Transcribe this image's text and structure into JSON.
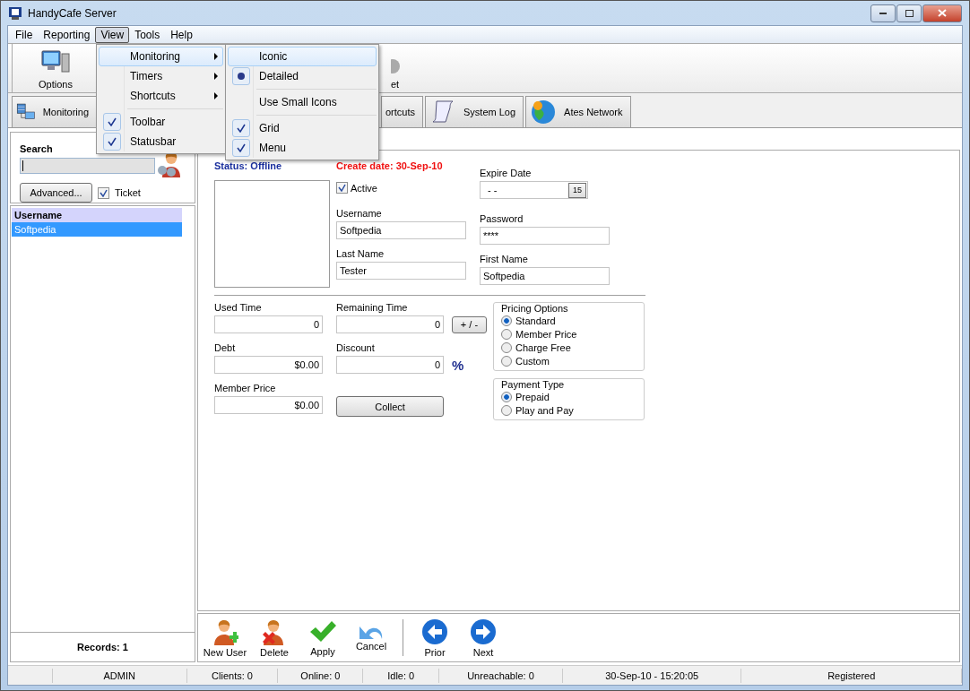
{
  "window": {
    "title": "HandyCafe Server"
  },
  "menu_bar": [
    {
      "label": "File",
      "selected": false
    },
    {
      "label": "Reporting",
      "selected": false
    },
    {
      "label": "View",
      "selected": true
    },
    {
      "label": "Tools",
      "selected": false
    },
    {
      "label": "Help",
      "selected": false
    }
  ],
  "toolbar": {
    "buttons": [
      {
        "label": "Options",
        "kind": "computer"
      },
      {
        "label": "et",
        "kind": "partial"
      }
    ]
  },
  "tabs": [
    {
      "label": "Monitoring",
      "kind": "servers",
      "selected": false
    },
    {
      "label": "ortcuts",
      "kind": "plain",
      "selected": false
    },
    {
      "label": "System Log",
      "kind": "scroll",
      "selected": false
    },
    {
      "label": "Ates Network",
      "kind": "globe",
      "selected": false
    }
  ],
  "view_menu": [
    {
      "kind": "submenu",
      "label": "Monitoring",
      "selected": true
    },
    {
      "kind": "submenu",
      "label": "Timers",
      "selected": false
    },
    {
      "kind": "submenu",
      "label": "Shortcuts",
      "selected": false
    },
    {
      "kind": "separator"
    },
    {
      "kind": "check",
      "label": "Toolbar",
      "checked": true,
      "selected": false
    },
    {
      "kind": "check",
      "label": "Statusbar",
      "checked": true,
      "selected": false
    }
  ],
  "monitoring_submenu": [
    {
      "kind": "radio",
      "label": "Iconic",
      "checked": false,
      "selected": true
    },
    {
      "kind": "radio",
      "label": "Detailed",
      "checked": true,
      "selected": false
    },
    {
      "kind": "separator"
    },
    {
      "kind": "check",
      "label": "Use Small Icons",
      "checked": false,
      "selected": false
    },
    {
      "kind": "separator"
    },
    {
      "kind": "check",
      "label": "Grid",
      "checked": true,
      "selected": false
    },
    {
      "kind": "check",
      "label": "Menu",
      "checked": true,
      "selected": false
    }
  ],
  "search": {
    "label": "Search",
    "advanced_button": "Advanced...",
    "ticket": {
      "label": "Ticket",
      "checked": true
    }
  },
  "user_list": {
    "header": "Username",
    "rows": [
      {
        "label": "Softpedia",
        "selected": true
      }
    ],
    "records": "Records: 1"
  },
  "details": {
    "status": "Status: Offline",
    "create_date": "Create date: 30-Sep-10",
    "active": {
      "label": "Active",
      "checked": true
    },
    "expire_date": {
      "label": "Expire Date",
      "value": "- -",
      "calendar": "15"
    },
    "username": {
      "label": "Username",
      "value": "Softpedia"
    },
    "password": {
      "label": "Password",
      "value": "****"
    },
    "last_name": {
      "label": "Last Name",
      "value": "Tester"
    },
    "first_name": {
      "label": "First Name",
      "value": "Softpedia"
    },
    "used_time": {
      "label": "Used Time",
      "value": "0"
    },
    "remaining_time": {
      "label": "Remaining Time",
      "value": "0",
      "button": "+ / -"
    },
    "debt": {
      "label": "Debt",
      "value": "$0.00"
    },
    "discount": {
      "label": "Discount",
      "value": "0",
      "unit": "%"
    },
    "member_price": {
      "label": "Member Price",
      "value": "$0.00"
    },
    "collect_button": "Collect",
    "pricing_options": {
      "title": "Pricing Options",
      "options": [
        {
          "label": "Standard",
          "selected": true
        },
        {
          "label": "Member Price",
          "selected": false
        },
        {
          "label": "Charge Free",
          "selected": false
        },
        {
          "label": "Custom",
          "selected": false
        }
      ]
    },
    "payment_type": {
      "title": "Payment Type",
      "options": [
        {
          "label": "Prepaid",
          "selected": true
        },
        {
          "label": "Play and Pay",
          "selected": false
        }
      ]
    }
  },
  "user_toolbar": [
    {
      "label": "New User",
      "kind": "new-user"
    },
    {
      "label": "Delete",
      "kind": "delete-user"
    },
    {
      "label": "Apply",
      "kind": "apply"
    },
    {
      "label": "Cancel",
      "kind": "cancel"
    },
    {
      "label": "Prior",
      "kind": "prior",
      "separator_before": true
    },
    {
      "label": "Next",
      "kind": "next"
    }
  ],
  "status_bar": [
    "ADMIN",
    "Clients: 0",
    "Online: 0",
    "Idle: 0",
    "Unreachable: 0",
    "30-Sep-10 - 15:20:05",
    "Registered"
  ]
}
